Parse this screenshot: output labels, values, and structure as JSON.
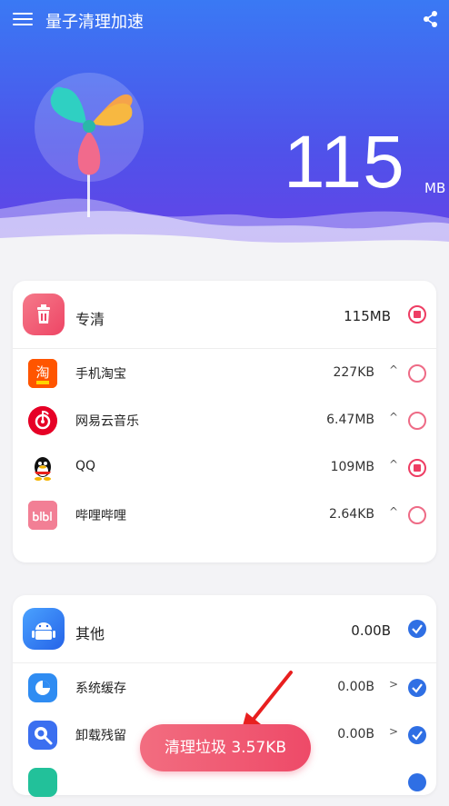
{
  "header": {
    "title": "量子清理加速"
  },
  "hero": {
    "value": "115",
    "unit": "MB"
  },
  "groups": [
    {
      "label": "专清",
      "size": "115MB",
      "items": [
        {
          "label": "手机淘宝",
          "size": "227KB"
        },
        {
          "label": "网易云音乐",
          "size": "6.47MB"
        },
        {
          "label": "QQ",
          "size": "109MB"
        },
        {
          "label": "哔哩哔哩",
          "size": "2.64KB"
        }
      ]
    },
    {
      "label": "其他",
      "size": "0.00B",
      "items": [
        {
          "label": "系统缓存",
          "size": "0.00B"
        },
        {
          "label": "卸载残留",
          "size": "0.00B"
        }
      ]
    }
  ],
  "clean_button": {
    "label": "清理垃圾 3.57KB"
  },
  "colors": {
    "hero_top": "#3a79f4",
    "hero_bottom": "#6a3fe6",
    "accent_red": "#ee3d63",
    "accent_blue": "#2f6fe4",
    "background": "#f3f3f6"
  }
}
